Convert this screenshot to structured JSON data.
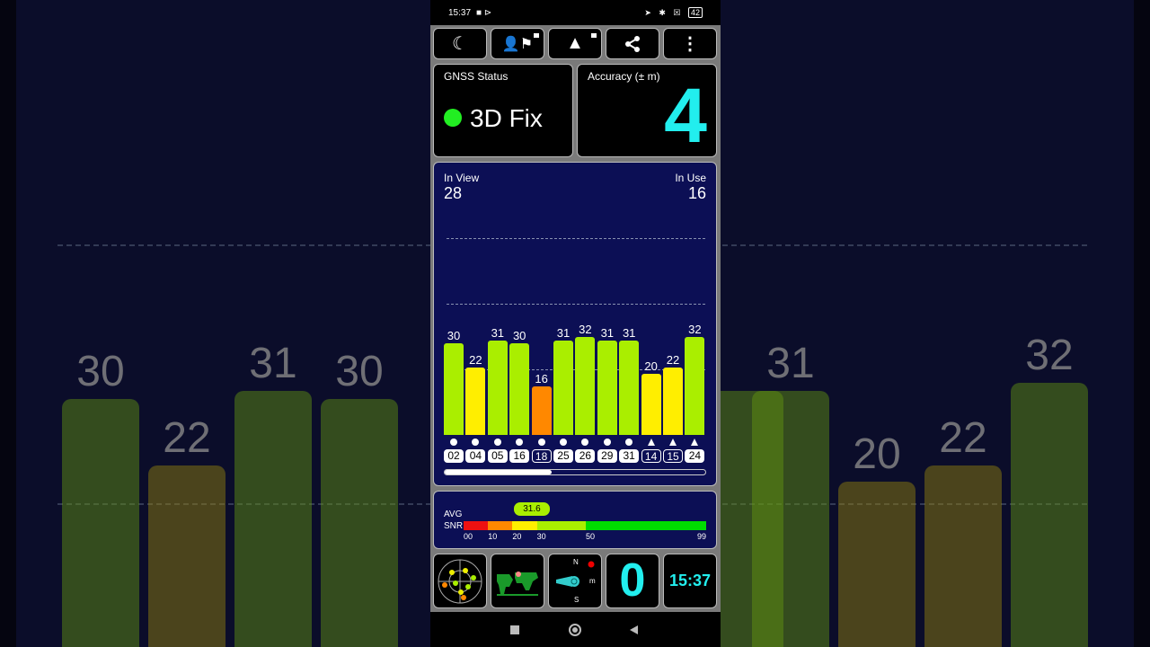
{
  "status_bar": {
    "time": "15:37",
    "right_icons": "location-icon bluetooth-icon sim-icon battery-icon",
    "battery": "42"
  },
  "toolbar": [
    {
      "icon": "moon-icon"
    },
    {
      "icon": "person-flag-icon",
      "locked": true
    },
    {
      "icon": "navigation-arrow-icon",
      "locked": true
    },
    {
      "icon": "share-icon"
    },
    {
      "icon": "more-vertical-icon"
    }
  ],
  "gnss": {
    "label": "GNSS Status",
    "value": "3D Fix",
    "color": "#22ee22"
  },
  "accuracy": {
    "label": "Accuracy (± m)",
    "value": "4",
    "color": "#22eeee"
  },
  "satellites": {
    "in_view_label": "In View",
    "in_view": "28",
    "in_use_label": "In Use",
    "in_use": "16",
    "scroll_fraction": 0.41,
    "list": [
      {
        "id": "02",
        "snr": 30,
        "shape": "circle",
        "in_use": true,
        "color": "#aaee00"
      },
      {
        "id": "04",
        "snr": 22,
        "shape": "circle",
        "in_use": true,
        "color": "#ffee00"
      },
      {
        "id": "05",
        "snr": 31,
        "shape": "circle",
        "in_use": true,
        "color": "#aaee00"
      },
      {
        "id": "16",
        "snr": 30,
        "shape": "circle",
        "in_use": true,
        "color": "#aaee00"
      },
      {
        "id": "18",
        "snr": 16,
        "shape": "circle",
        "in_use": false,
        "color": "#ff8800"
      },
      {
        "id": "25",
        "snr": 31,
        "shape": "circle",
        "in_use": true,
        "color": "#aaee00"
      },
      {
        "id": "26",
        "snr": 32,
        "shape": "circle",
        "in_use": true,
        "color": "#aaee00"
      },
      {
        "id": "29",
        "snr": 31,
        "shape": "circle",
        "in_use": true,
        "color": "#aaee00"
      },
      {
        "id": "31",
        "snr": 31,
        "shape": "circle",
        "in_use": true,
        "color": "#aaee00"
      },
      {
        "id": "14",
        "snr": 20,
        "shape": "triangle",
        "in_use": false,
        "color": "#ffee00"
      },
      {
        "id": "15",
        "snr": 22,
        "shape": "triangle",
        "in_use": false,
        "color": "#ffee00"
      },
      {
        "id": "24",
        "snr": 32,
        "shape": "triangle",
        "in_use": true,
        "color": "#aaee00"
      }
    ]
  },
  "snr": {
    "label1": "AVG",
    "label2": "SNR",
    "avg": "31.6",
    "segments": [
      {
        "from": 0,
        "to": 10,
        "color": "#ee1111"
      },
      {
        "from": 10,
        "to": 20,
        "color": "#ff8800"
      },
      {
        "from": 20,
        "to": 30,
        "color": "#ffee00"
      },
      {
        "from": 30,
        "to": 50,
        "color": "#aaee00"
      },
      {
        "from": 50,
        "to": 99,
        "color": "#00dd00"
      }
    ],
    "ticks": [
      "00",
      "10",
      "20",
      "30",
      "50",
      "99"
    ]
  },
  "bottom": {
    "tiles": [
      {
        "icon": "sky-plot-icon"
      },
      {
        "icon": "world-map-icon"
      },
      {
        "icon": "compass-icon",
        "n": "N",
        "s": "S",
        "m": "m"
      },
      {
        "value": "0"
      },
      {
        "value": "15:37"
      }
    ]
  },
  "nav": [
    {
      "icon": "recents-square-icon"
    },
    {
      "icon": "home-circle-icon"
    },
    {
      "icon": "back-triangle-icon"
    }
  ]
}
